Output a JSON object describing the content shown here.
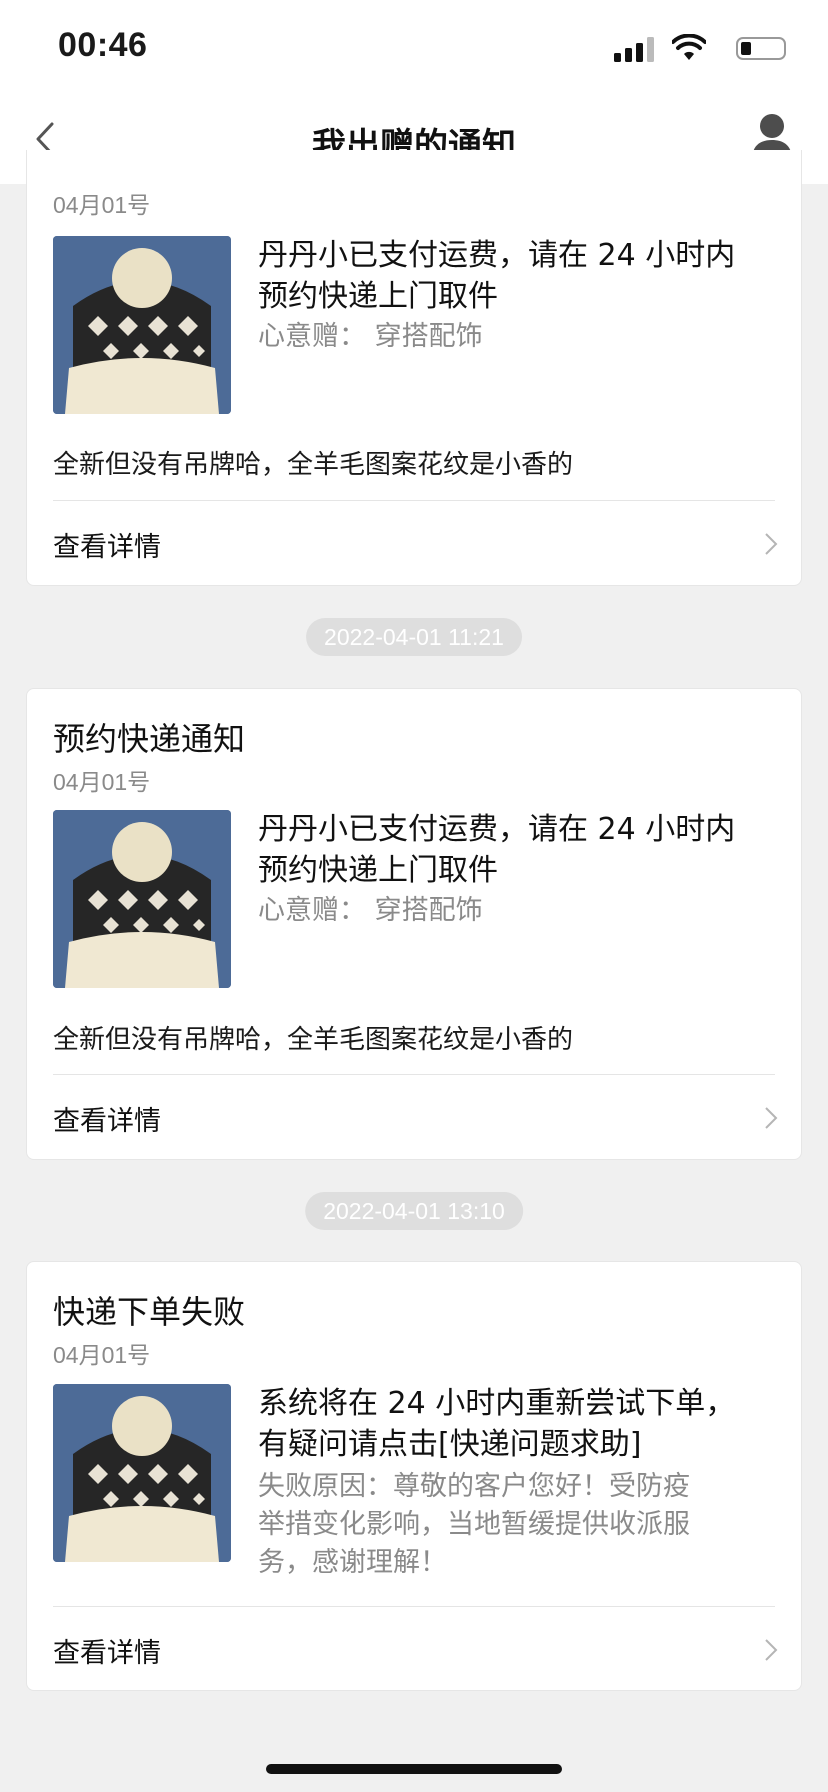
{
  "status_bar": {
    "time": "00:46"
  },
  "nav": {
    "title": "我出赠的通知"
  },
  "cards": [
    {
      "title": "",
      "date": "04月01号",
      "main_line1": "丹丹小已支付运费，请在 24 小时内",
      "main_line2": "预约快递上门取件",
      "sub_lines": [
        "心意赠：  穿搭配饰"
      ],
      "description": "全新但没有吊牌哈，全羊毛图案花纹是小香的",
      "detail_label": "查看详情"
    },
    {
      "timestamp": "2022-04-01 11:21",
      "title": "预约快递通知",
      "date": "04月01号",
      "main_line1": "丹丹小已支付运费，请在 24 小时内",
      "main_line2": "预约快递上门取件",
      "sub_lines": [
        "心意赠：  穿搭配饰"
      ],
      "description": "全新但没有吊牌哈，全羊毛图案花纹是小香的",
      "detail_label": "查看详情"
    },
    {
      "timestamp": "2022-04-01 13:10",
      "title": "快递下单失败",
      "date": "04月01号",
      "main_line1": "系统将在 24 小时内重新尝试下单，",
      "main_line2": "有疑问请点击[快递问题求助]",
      "sub_lines": [
        "失败原因：尊敬的客户您好！受防疫",
        "举措变化影响，当地暂缓提供收派服",
        "务，感谢理解！"
      ],
      "detail_label": "查看详情"
    }
  ],
  "colors": {
    "background": "#f0f0f0",
    "card": "#ffffff",
    "muted_text": "#8a8a8a",
    "pill": "#dedede"
  }
}
